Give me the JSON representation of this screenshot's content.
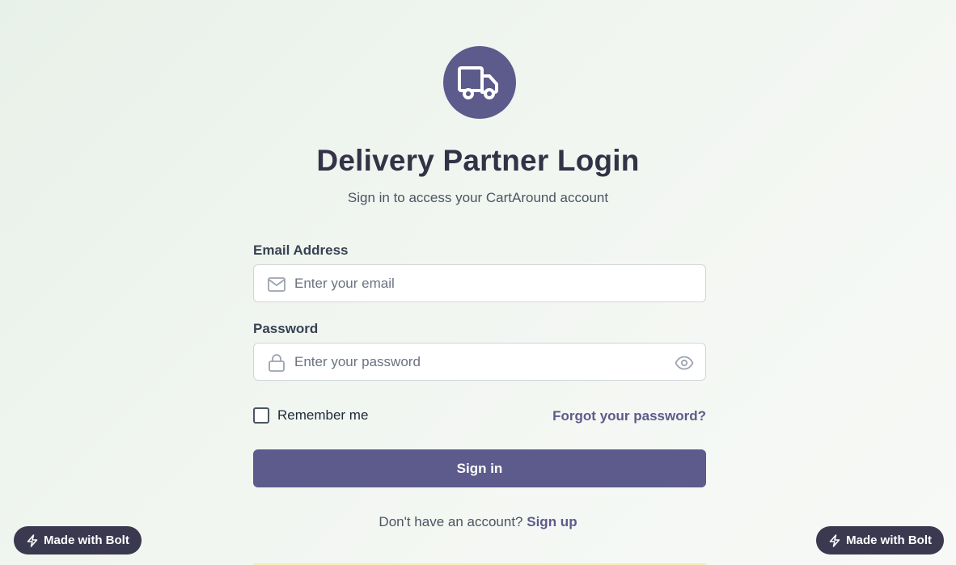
{
  "header": {
    "logo_icon": "truck-icon",
    "title": "Delivery Partner Login",
    "subtitle": "Sign in to access your CartAround account"
  },
  "form": {
    "email": {
      "label": "Email Address",
      "placeholder": "Enter your email",
      "icon": "mail-icon"
    },
    "password": {
      "label": "Password",
      "placeholder": "Enter your password",
      "icon": "lock-icon",
      "toggle_icon": "eye-icon"
    },
    "remember_label": "Remember me",
    "forgot_label": "Forgot your password?",
    "submit_label": "Sign in"
  },
  "footer": {
    "prompt": "Don't have an account?",
    "signup_label": "Sign up"
  },
  "badges": {
    "bolt_label": "Made with Bolt",
    "bolt_icon": "lightning-icon"
  },
  "colors": {
    "accent": "#5d5a8c",
    "title": "#343246",
    "badge": "#3a3950"
  }
}
